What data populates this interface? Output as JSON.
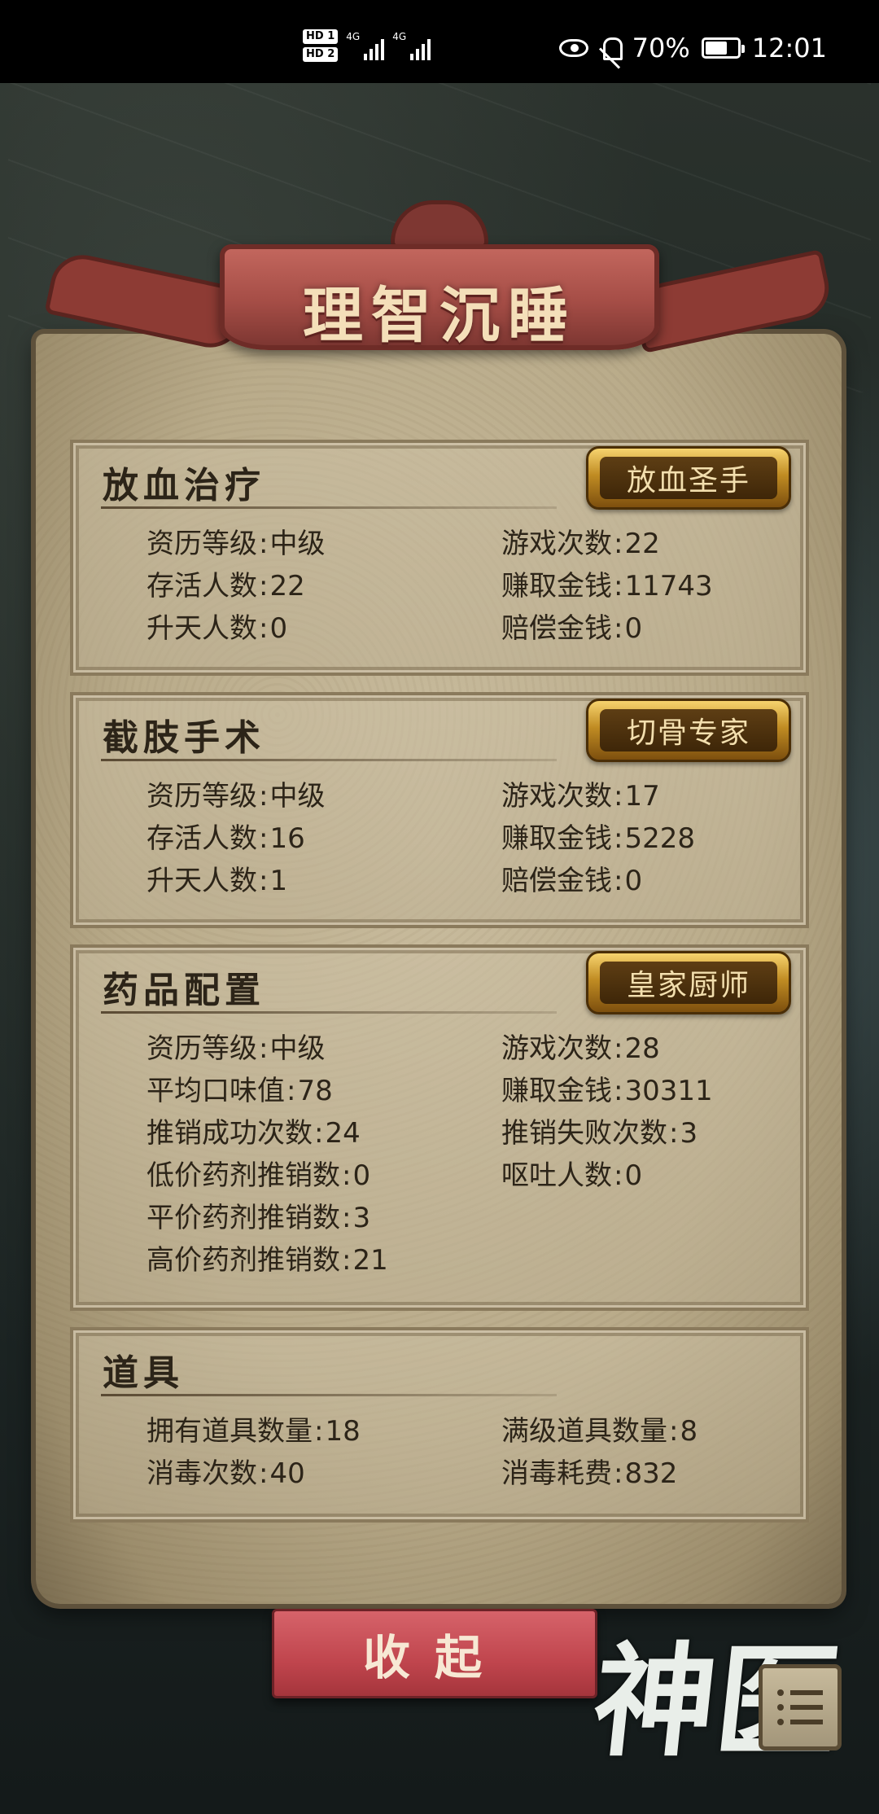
{
  "status_bar": {
    "sim1": "HD 1",
    "sim2": "HD 2",
    "network1": "4G",
    "network2": "4G",
    "battery": "70%",
    "time": "12:01",
    "icons": [
      "eye-icon",
      "bell-mute-icon",
      "battery-icon"
    ]
  },
  "title": "理智沉睡",
  "sections": [
    {
      "title": "放血治疗",
      "badge": "放血圣手",
      "stats": [
        {
          "key": "资历等级",
          "value": "中级"
        },
        {
          "key": "游戏次数",
          "value": "22"
        },
        {
          "key": "存活人数",
          "value": "22"
        },
        {
          "key": "赚取金钱",
          "value": "11743"
        },
        {
          "key": "升天人数",
          "value": "0"
        },
        {
          "key": "赔偿金钱",
          "value": "0"
        }
      ]
    },
    {
      "title": "截肢手术",
      "badge": "切骨专家",
      "stats": [
        {
          "key": "资历等级",
          "value": "中级"
        },
        {
          "key": "游戏次数",
          "value": "17"
        },
        {
          "key": "存活人数",
          "value": "16"
        },
        {
          "key": "赚取金钱",
          "value": "5228"
        },
        {
          "key": "升天人数",
          "value": "1"
        },
        {
          "key": "赔偿金钱",
          "value": "0"
        }
      ]
    },
    {
      "title": "药品配置",
      "badge": "皇家厨师",
      "stats": [
        {
          "key": "资历等级",
          "value": "中级"
        },
        {
          "key": "游戏次数",
          "value": "28"
        },
        {
          "key": "平均口味值",
          "value": "78"
        },
        {
          "key": "赚取金钱",
          "value": "30311"
        },
        {
          "key": "推销成功次数",
          "value": "24"
        },
        {
          "key": "推销失败次数",
          "value": "3"
        },
        {
          "key": "低价药剂推销数",
          "value": "0"
        },
        {
          "key": "呕吐人数",
          "value": "0"
        },
        {
          "key": "平价药剂推销数",
          "value": "3"
        },
        {
          "key": "高价药剂推销数",
          "value": "21"
        }
      ]
    },
    {
      "title": "道具",
      "stats": [
        {
          "key": "拥有道具数量",
          "value": "18"
        },
        {
          "key": "满级道具数量",
          "value": "8"
        },
        {
          "key": "消毒次数",
          "value": "40"
        },
        {
          "key": "消毒耗费",
          "value": "832"
        }
      ]
    }
  ],
  "collapse_button": "收起",
  "logo_text": "神医",
  "colors": {
    "paper": "#c9bc9e",
    "banner": "#a54d46",
    "button": "#c0454d",
    "badge_gold": "#c08c23",
    "text": "#2c2418"
  }
}
